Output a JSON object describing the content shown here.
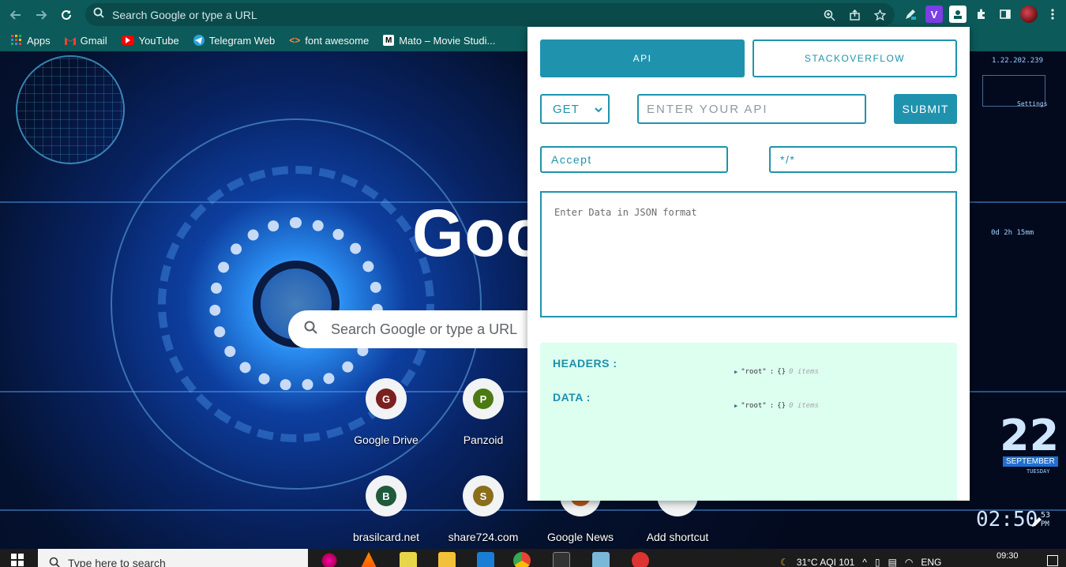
{
  "browser": {
    "omnibox_placeholder": "Search Google or type a URL",
    "bookmarks": [
      {
        "label": "Apps",
        "icon": "apps-grid-icon"
      },
      {
        "label": "Gmail",
        "icon": "gmail-icon"
      },
      {
        "label": "YouTube",
        "icon": "youtube-icon"
      },
      {
        "label": "Telegram Web",
        "icon": "telegram-icon"
      },
      {
        "label": "font awesome",
        "icon": "code-icon"
      },
      {
        "label": "Mato – Movie Studi...",
        "icon": "mato-icon"
      }
    ],
    "extension_v_label": "V"
  },
  "newtab": {
    "logo_text": "Goo",
    "search_placeholder": "Search Google or type a URL",
    "shortcuts": [
      {
        "letter": "G",
        "label": "Google Drive",
        "color": "#7a2020"
      },
      {
        "letter": "P",
        "label": "Panzoid",
        "color": "#4c7a12"
      },
      {
        "letter": "B",
        "label": "brasilcard.net",
        "color": "#1f5a3a"
      },
      {
        "letter": "S",
        "label": "share724.com",
        "color": "#8a6e1a"
      },
      {
        "letter": "",
        "label": "Google News",
        "color": "#b35a1a"
      },
      {
        "letter": "+",
        "label": "Add shortcut",
        "color": "#5f6368"
      }
    ],
    "hud": {
      "ip": "1.22.202.239",
      "settings_label": "Settings",
      "countdown": "0d 2h 15mm",
      "day_number": "22",
      "month_label": "SEPTEMBER",
      "weekday": "TUESDAY",
      "clock": "02:50",
      "clock_seconds": "53",
      "clock_suffix": "PM"
    }
  },
  "popup": {
    "tabs": {
      "api": "API",
      "stackoverflow": "STACKOVERFLOW"
    },
    "method_selected": "GET",
    "api_placeholder": "ENTER YOUR API",
    "submit_label": "SUBMIT",
    "header_key": "Accept",
    "header_value": "*/*",
    "json_placeholder": "Enter Data in JSON format",
    "response": {
      "headers_label": "HEADERS :",
      "data_label": "DATA :",
      "headers_node": {
        "key": "\"root\"",
        "sep": ":",
        "value": "{}",
        "meta": "0 items"
      },
      "data_node": {
        "key": "\"root\"",
        "sep": ":",
        "value": "{}",
        "meta": "0 items"
      }
    },
    "accent_color": "#1f93ad",
    "response_bg": "#dcfff0"
  },
  "taskbar": {
    "search_placeholder": "Type here to search",
    "weather": "31°C  AQI 101",
    "language": "ENG",
    "time": "09:30"
  }
}
